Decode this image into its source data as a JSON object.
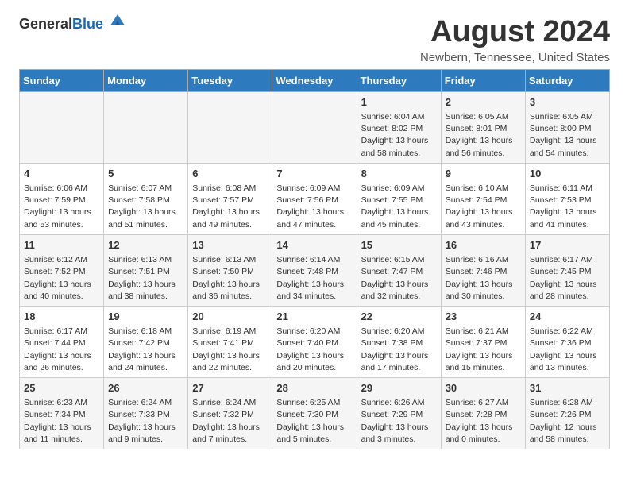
{
  "header": {
    "logo_general": "General",
    "logo_blue": "Blue",
    "month": "August 2024",
    "location": "Newbern, Tennessee, United States"
  },
  "weekdays": [
    "Sunday",
    "Monday",
    "Tuesday",
    "Wednesday",
    "Thursday",
    "Friday",
    "Saturday"
  ],
  "weeks": [
    [
      {
        "day": "",
        "text": ""
      },
      {
        "day": "",
        "text": ""
      },
      {
        "day": "",
        "text": ""
      },
      {
        "day": "",
        "text": ""
      },
      {
        "day": "1",
        "text": "Sunrise: 6:04 AM\nSunset: 8:02 PM\nDaylight: 13 hours\nand 58 minutes."
      },
      {
        "day": "2",
        "text": "Sunrise: 6:05 AM\nSunset: 8:01 PM\nDaylight: 13 hours\nand 56 minutes."
      },
      {
        "day": "3",
        "text": "Sunrise: 6:05 AM\nSunset: 8:00 PM\nDaylight: 13 hours\nand 54 minutes."
      }
    ],
    [
      {
        "day": "4",
        "text": "Sunrise: 6:06 AM\nSunset: 7:59 PM\nDaylight: 13 hours\nand 53 minutes."
      },
      {
        "day": "5",
        "text": "Sunrise: 6:07 AM\nSunset: 7:58 PM\nDaylight: 13 hours\nand 51 minutes."
      },
      {
        "day": "6",
        "text": "Sunrise: 6:08 AM\nSunset: 7:57 PM\nDaylight: 13 hours\nand 49 minutes."
      },
      {
        "day": "7",
        "text": "Sunrise: 6:09 AM\nSunset: 7:56 PM\nDaylight: 13 hours\nand 47 minutes."
      },
      {
        "day": "8",
        "text": "Sunrise: 6:09 AM\nSunset: 7:55 PM\nDaylight: 13 hours\nand 45 minutes."
      },
      {
        "day": "9",
        "text": "Sunrise: 6:10 AM\nSunset: 7:54 PM\nDaylight: 13 hours\nand 43 minutes."
      },
      {
        "day": "10",
        "text": "Sunrise: 6:11 AM\nSunset: 7:53 PM\nDaylight: 13 hours\nand 41 minutes."
      }
    ],
    [
      {
        "day": "11",
        "text": "Sunrise: 6:12 AM\nSunset: 7:52 PM\nDaylight: 13 hours\nand 40 minutes."
      },
      {
        "day": "12",
        "text": "Sunrise: 6:13 AM\nSunset: 7:51 PM\nDaylight: 13 hours\nand 38 minutes."
      },
      {
        "day": "13",
        "text": "Sunrise: 6:13 AM\nSunset: 7:50 PM\nDaylight: 13 hours\nand 36 minutes."
      },
      {
        "day": "14",
        "text": "Sunrise: 6:14 AM\nSunset: 7:48 PM\nDaylight: 13 hours\nand 34 minutes."
      },
      {
        "day": "15",
        "text": "Sunrise: 6:15 AM\nSunset: 7:47 PM\nDaylight: 13 hours\nand 32 minutes."
      },
      {
        "day": "16",
        "text": "Sunrise: 6:16 AM\nSunset: 7:46 PM\nDaylight: 13 hours\nand 30 minutes."
      },
      {
        "day": "17",
        "text": "Sunrise: 6:17 AM\nSunset: 7:45 PM\nDaylight: 13 hours\nand 28 minutes."
      }
    ],
    [
      {
        "day": "18",
        "text": "Sunrise: 6:17 AM\nSunset: 7:44 PM\nDaylight: 13 hours\nand 26 minutes."
      },
      {
        "day": "19",
        "text": "Sunrise: 6:18 AM\nSunset: 7:42 PM\nDaylight: 13 hours\nand 24 minutes."
      },
      {
        "day": "20",
        "text": "Sunrise: 6:19 AM\nSunset: 7:41 PM\nDaylight: 13 hours\nand 22 minutes."
      },
      {
        "day": "21",
        "text": "Sunrise: 6:20 AM\nSunset: 7:40 PM\nDaylight: 13 hours\nand 20 minutes."
      },
      {
        "day": "22",
        "text": "Sunrise: 6:20 AM\nSunset: 7:38 PM\nDaylight: 13 hours\nand 17 minutes."
      },
      {
        "day": "23",
        "text": "Sunrise: 6:21 AM\nSunset: 7:37 PM\nDaylight: 13 hours\nand 15 minutes."
      },
      {
        "day": "24",
        "text": "Sunrise: 6:22 AM\nSunset: 7:36 PM\nDaylight: 13 hours\nand 13 minutes."
      }
    ],
    [
      {
        "day": "25",
        "text": "Sunrise: 6:23 AM\nSunset: 7:34 PM\nDaylight: 13 hours\nand 11 minutes."
      },
      {
        "day": "26",
        "text": "Sunrise: 6:24 AM\nSunset: 7:33 PM\nDaylight: 13 hours\nand 9 minutes."
      },
      {
        "day": "27",
        "text": "Sunrise: 6:24 AM\nSunset: 7:32 PM\nDaylight: 13 hours\nand 7 minutes."
      },
      {
        "day": "28",
        "text": "Sunrise: 6:25 AM\nSunset: 7:30 PM\nDaylight: 13 hours\nand 5 minutes."
      },
      {
        "day": "29",
        "text": "Sunrise: 6:26 AM\nSunset: 7:29 PM\nDaylight: 13 hours\nand 3 minutes."
      },
      {
        "day": "30",
        "text": "Sunrise: 6:27 AM\nSunset: 7:28 PM\nDaylight: 13 hours\nand 0 minutes."
      },
      {
        "day": "31",
        "text": "Sunrise: 6:28 AM\nSunset: 7:26 PM\nDaylight: 12 hours\nand 58 minutes."
      }
    ]
  ]
}
